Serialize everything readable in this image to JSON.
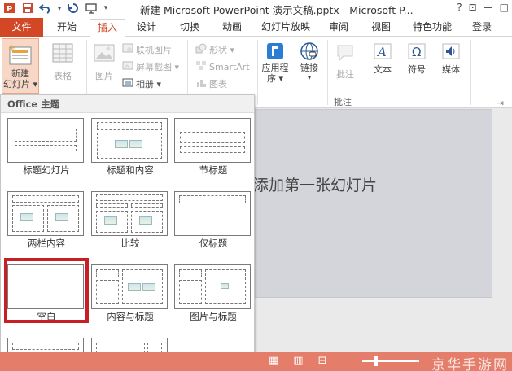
{
  "window": {
    "title": "新建 Microsoft PowerPoint 演示文稿.pptx - Microsoft P...",
    "controls": [
      "?",
      "⊡",
      "—",
      "□"
    ]
  },
  "tabs": [
    {
      "label": "文件"
    },
    {
      "label": "开始"
    },
    {
      "label": "插入"
    },
    {
      "label": "设计"
    },
    {
      "label": "切换"
    },
    {
      "label": "动画"
    },
    {
      "label": "幻灯片放映"
    },
    {
      "label": "审阅"
    },
    {
      "label": "视图"
    },
    {
      "label": "特色功能"
    },
    {
      "label": "登录"
    }
  ],
  "ribbon": {
    "new_slide": "新建\n幻灯片",
    "new_slide_line1": "新建",
    "new_slide_line2": "幻灯片 ▾",
    "table": "表格",
    "images": "图片",
    "online_pictures": "联机图片",
    "screenshot": "屏幕截图 ▾",
    "album": "相册 ▾",
    "shapes": "形状 ▾",
    "smartart": "SmartArt",
    "chart": "图表",
    "apps": "应用程",
    "apps2": "序 ▾",
    "links": "链接",
    "links_arrow": "▾",
    "comment": "批注",
    "comment_group": "批注",
    "text": "文本",
    "symbols": "符号",
    "media": "媒体"
  },
  "dropdown": {
    "header": "Office 主题",
    "layouts": [
      {
        "name": "标题幻灯片"
      },
      {
        "name": "标题和内容"
      },
      {
        "name": "节标题"
      },
      {
        "name": "两栏内容"
      },
      {
        "name": "比较"
      },
      {
        "name": "仅标题"
      },
      {
        "name": "空白"
      },
      {
        "name": "内容与标题"
      },
      {
        "name": "图片与标题"
      }
    ]
  },
  "slide": {
    "hint": "添加第一张幻灯片"
  },
  "panel_collapse": "⇥",
  "statusbar": {
    "watermark": "京华手游网"
  },
  "colors": {
    "accent": "#d24726",
    "selection": "#c81f24",
    "statusbar": "#e47e6b"
  }
}
